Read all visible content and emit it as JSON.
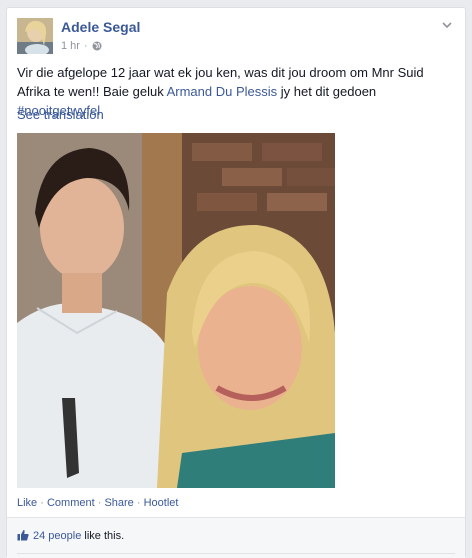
{
  "post": {
    "author": "Adele Segal",
    "time": "1 hr",
    "dot": "·",
    "text_parts": {
      "p1": "Vir die afgelope 12 jaar wat ek jou ken, was dit jou droom om Mnr Suid Afrika te wen!! Baie geluk ",
      "mention": "Armand Du Plessis",
      "p2": " jy het dit gedoen ",
      "hashtag": "#nooitgetwyfel"
    },
    "see_translation": "See translation"
  },
  "actions": {
    "like": "Like",
    "comment": "Comment",
    "share": "Share",
    "app": "Hootlet",
    "sep": " · "
  },
  "likes": {
    "count": "24 people",
    "suffix": " like this."
  },
  "colors": {
    "link": "#3b5998",
    "meta": "#90949c",
    "background": "#e9ebee"
  }
}
